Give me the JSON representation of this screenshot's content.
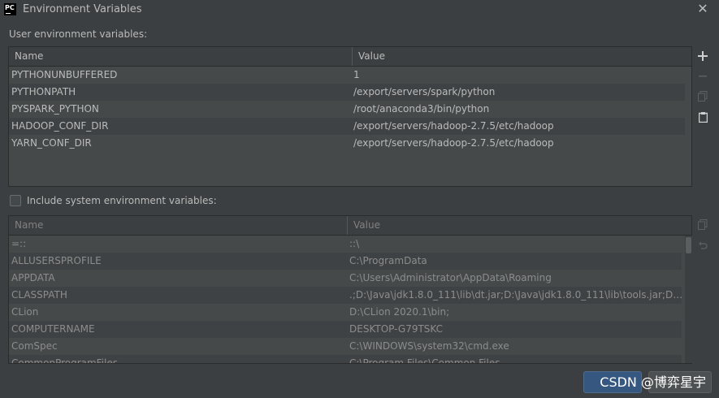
{
  "window": {
    "title": "Environment Variables",
    "app_icon_text": "PC"
  },
  "user_section": {
    "label": "User environment variables:",
    "columns": [
      "Name",
      "Value"
    ],
    "rows": [
      {
        "name": "PYTHONUNBUFFERED",
        "value": "1"
      },
      {
        "name": "PYTHONPATH",
        "value": "/export/servers/spark/python"
      },
      {
        "name": "PYSPARK_PYTHON",
        "value": "/root/anaconda3/bin/python"
      },
      {
        "name": "HADOOP_CONF_DIR",
        "value": "/export/servers/hadoop-2.7.5/etc/hadoop"
      },
      {
        "name": "YARN_CONF_DIR",
        "value": "/export/servers/hadoop-2.7.5/etc/hadoop"
      }
    ]
  },
  "include_system": {
    "label": "Include system environment variables:",
    "checked": false
  },
  "system_section": {
    "columns": [
      "Name",
      "Value"
    ],
    "rows": [
      {
        "name": "=::",
        "value": "::\\"
      },
      {
        "name": "ALLUSERSPROFILE",
        "value": "C:\\ProgramData"
      },
      {
        "name": "APPDATA",
        "value": "C:\\Users\\Administrator\\AppData\\Roaming"
      },
      {
        "name": "CLASSPATH",
        "value": ".;D:\\Java\\jdk1.8.0_111\\lib\\dt.jar;D:\\Java\\jdk1.8.0_111\\lib\\tools.jar;D:\\J..."
      },
      {
        "name": "CLion",
        "value": "D:\\CLion 2020.1\\bin;"
      },
      {
        "name": "COMPUTERNAME",
        "value": "DESKTOP-G79TSKC"
      },
      {
        "name": "ComSpec",
        "value": "C:\\WINDOWS\\system32\\cmd.exe"
      },
      {
        "name": "CommonProgramFiles",
        "value": "C:\\Program Files\\Common Files"
      }
    ]
  },
  "toolbar_icons": {
    "add": "plus-icon",
    "remove": "minus-icon",
    "copy": "copy-icon",
    "paste": "paste-icon",
    "system_copy": "copy-icon",
    "system_revert": "undo-icon"
  },
  "watermark": "CSDN @博弈星宇"
}
